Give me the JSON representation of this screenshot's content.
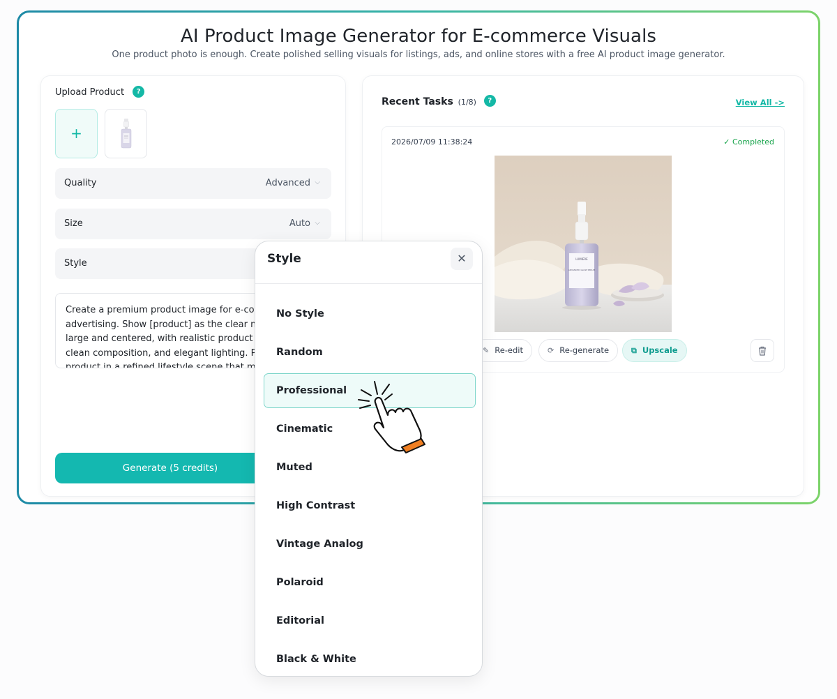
{
  "header": {
    "title": "AI Product Image Generator for E-commerce Visuals",
    "subtitle": "One product photo is enough. Create polished selling visuals for listings, ads, and online stores with a free AI product image generator."
  },
  "upload": {
    "label": "Upload Product",
    "help": "?",
    "add": "+"
  },
  "options": {
    "quality": {
      "label": "Quality",
      "value": "Advanced"
    },
    "size": {
      "label": "Size",
      "value": "Auto"
    },
    "style": {
      "label": "Style"
    },
    "chevron": "⌵"
  },
  "prompt": {
    "text": "Create a premium product image for e-commerce advertising. Show [product] as the clear main subject, large and centered, with realistic product photography, clean composition, and elegant lighting. Place the product in a refined lifestyle scene that matches"
  },
  "generate": {
    "label": "Generate (5 credits)"
  },
  "recent": {
    "title": "Recent Tasks",
    "count": "(1/8)",
    "help": "?",
    "view_all": "View All ->",
    "task": {
      "time": "2026/07/09 11:38:24",
      "status": "✓ Completed",
      "product_brand": "LUMIERE",
      "product_line": "ADVANCED GLOW SERUM",
      "actions": {
        "reedit": "Re-edit",
        "regenerate": "Re-generate",
        "upscale": "Upscale"
      }
    }
  },
  "modal": {
    "title": "Style",
    "close": "✕",
    "items": [
      "No Style",
      "Random",
      "Professional",
      "Cinematic",
      "Muted",
      "High Contrast",
      "Vintage Analog",
      "Polaroid",
      "Editorial",
      "Black & White"
    ],
    "selected": "Professional"
  },
  "colors": {
    "accent": "#14b8a6",
    "button": "#14b8b0",
    "status_green": "#16a34a",
    "border_gradient_start": "#1d8aa6",
    "border_gradient_end": "#7cd36a"
  }
}
